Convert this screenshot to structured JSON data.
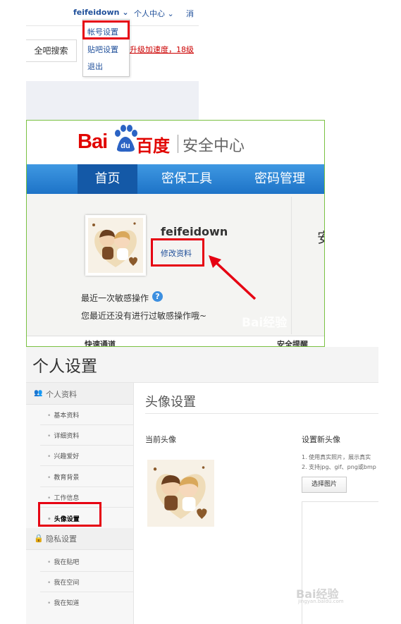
{
  "tieba_header": {
    "username": "feifeidown",
    "personal_center": "个人中心",
    "messages": "消",
    "search_label": "全吧搜索",
    "promo_text": "升级加速度，18级",
    "dropdown": [
      "帐号设置",
      "贴吧设置",
      "退出"
    ]
  },
  "security_center": {
    "logo_bai": "Bai",
    "logo_du": "du",
    "logo_baidu": "百度",
    "logo_title": "安全中心",
    "nav": [
      "首页",
      "密保工具",
      "密码管理"
    ],
    "username": "feifeidown",
    "edit_profile": "修改资料",
    "last_sensitive_op": "最近一次敏感操作",
    "help_icon": "?",
    "no_sensitive_op": "您最近还没有进行过敏感操作哦~",
    "cut_text": "安",
    "bottom_tab_left": "快速通道",
    "bottom_tab_right": "安全提醒",
    "watermark": "Bai经验"
  },
  "personal_settings": {
    "title": "个人设置",
    "sidebar": {
      "section1": "个人资料",
      "section1_items": [
        "基本资料",
        "详细资料",
        "兴趣爱好",
        "教育背景",
        "工作信息",
        "头像设置"
      ],
      "section2": "隐私设置",
      "section2_items": [
        "我在贴吧",
        "我在空间",
        "我在知道"
      ]
    },
    "main_title": "头像设置",
    "current_avatar_label": "当前头像",
    "new_avatar_label": "设置新头像",
    "tips": [
      "1. 使用真实照片，展示真实",
      "2. 支持jpg、gif、png或bmp"
    ],
    "choose_button": "选择图片",
    "watermark": "Bai经验",
    "watermark_sub": "jingyan.baidu.com"
  },
  "colors": {
    "highlight_red": "#e60012",
    "link_blue": "#1f4f9a",
    "nav_blue": "#2a82d4",
    "baidu_red": "#e10602"
  }
}
